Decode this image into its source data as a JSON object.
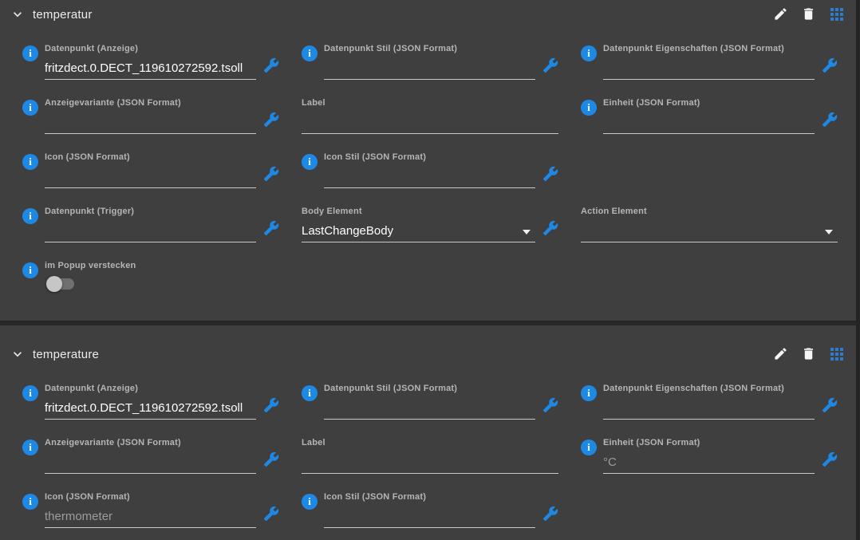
{
  "colors": {
    "background": "#3f3f3f",
    "accent_blue": "#1e88e5",
    "drag_grid_blue": "#2e7bd0",
    "label_text": "#b5b5b5",
    "value_text": "#ffffff",
    "value_dim_text": "#9c9c9c",
    "underline": "#c9c9c9",
    "divider": "#282828",
    "scrollbar": "#242424"
  },
  "icons": {
    "collapse": "chevron-down-icon",
    "info": "info-icon",
    "edit": "pencil-icon",
    "delete": "trash-icon",
    "drag": "drag-grid-icon",
    "configure": "wrench-icon",
    "dropdown": "caret-down-icon"
  },
  "panel1": {
    "title": "temperatur",
    "fields": {
      "datenpunkt_anzeige": {
        "label": "Datenpunkt (Anzeige)",
        "value": "fritzdect.0.DECT_119610272592.tsoll"
      },
      "datenpunkt_stil": {
        "label": "Datenpunkt Stil (JSON Format)",
        "value": ""
      },
      "datenpunkt_eigenschaften": {
        "label": "Datenpunkt Eigenschaften (JSON Format)",
        "value": ""
      },
      "anzeigevariante": {
        "label": "Anzeigevariante (JSON Format)",
        "value": ""
      },
      "label": {
        "label": "Label",
        "value": ""
      },
      "einheit": {
        "label": "Einheit (JSON Format)",
        "value": ""
      },
      "icon": {
        "label": "Icon (JSON Format)",
        "value": ""
      },
      "icon_stil": {
        "label": "Icon Stil (JSON Format)",
        "value": ""
      },
      "datenpunkt_trigger": {
        "label": "Datenpunkt (Trigger)",
        "value": ""
      },
      "body_element": {
        "label": "Body Element",
        "value": "LastChangeBody"
      },
      "action_element": {
        "label": "Action Element",
        "value": ""
      },
      "im_popup_verstecken": {
        "label": "im Popup verstecken",
        "state": "off"
      }
    }
  },
  "panel2": {
    "title": "temperature",
    "fields": {
      "datenpunkt_anzeige": {
        "label": "Datenpunkt (Anzeige)",
        "value": "fritzdect.0.DECT_119610272592.tsoll"
      },
      "datenpunkt_stil": {
        "label": "Datenpunkt Stil (JSON Format)",
        "value": ""
      },
      "datenpunkt_eigenschaften": {
        "label": "Datenpunkt Eigenschaften (JSON Format)",
        "value": ""
      },
      "anzeigevariante": {
        "label": "Anzeigevariante (JSON Format)",
        "value": ""
      },
      "label": {
        "label": "Label",
        "value": ""
      },
      "einheit": {
        "label": "Einheit (JSON Format)",
        "value": "°C"
      },
      "icon": {
        "label": "Icon (JSON Format)",
        "value": "thermometer"
      },
      "icon_stil": {
        "label": "Icon Stil (JSON Format)",
        "value": ""
      }
    }
  }
}
